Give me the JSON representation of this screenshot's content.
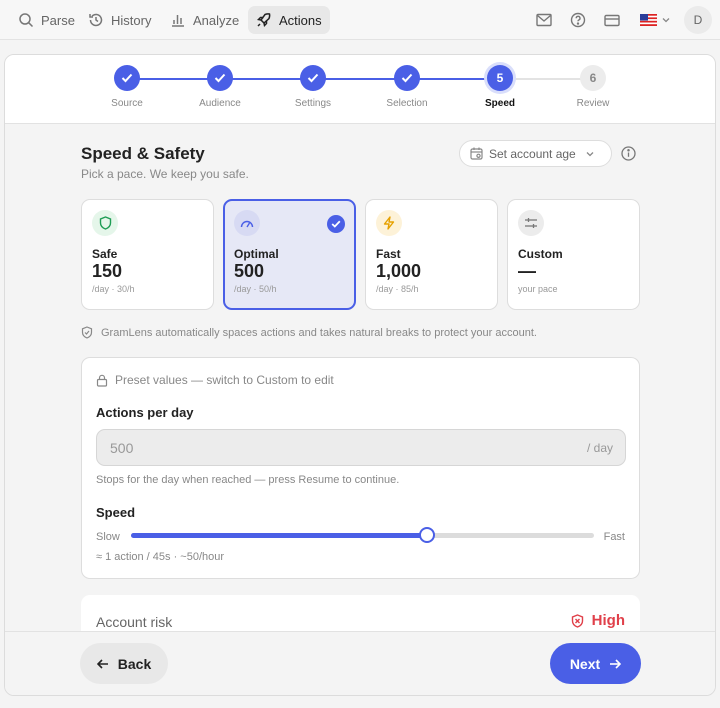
{
  "nav": {
    "items": [
      {
        "label": "Parse",
        "icon": "search-icon"
      },
      {
        "label": "History",
        "icon": "history-icon"
      },
      {
        "label": "Analyze",
        "icon": "bar-chart-icon"
      },
      {
        "label": "Actions",
        "icon": "rocket-icon"
      }
    ],
    "active": "Actions",
    "avatar": "D"
  },
  "steps": [
    {
      "number": "1",
      "label": "Source",
      "state": "done"
    },
    {
      "number": "2",
      "label": "Audience",
      "state": "done"
    },
    {
      "number": "3",
      "label": "Settings",
      "state": "done"
    },
    {
      "number": "4",
      "label": "Selection",
      "state": "done"
    },
    {
      "number": "5",
      "label": "Speed",
      "state": "current"
    },
    {
      "number": "6",
      "label": "Review",
      "state": "todo"
    }
  ],
  "page": {
    "title": "Speed & Safety",
    "subtitle": "Pick a pace. We keep you safe.",
    "account_age_label": "Set account age"
  },
  "presets": [
    {
      "name": "Safe",
      "value": "150",
      "meta": "/day · 30/h",
      "icon": "shield-icon",
      "selected": false
    },
    {
      "name": "Optimal",
      "value": "500",
      "meta": "/day · 50/h",
      "icon": "gauge-icon",
      "selected": true
    },
    {
      "name": "Fast",
      "value": "1,000",
      "meta": "/day · 85/h",
      "icon": "bolt-icon",
      "selected": false
    },
    {
      "name": "Custom",
      "value": "—",
      "meta": "your pace",
      "icon": "sliders-icon",
      "selected": false
    }
  ],
  "notice": "GramLens automatically spaces actions and takes natural breaks to protect your account.",
  "settings": {
    "preset_note": "Preset values — switch to Custom to edit",
    "actions_label": "Actions per day",
    "actions_value": "500",
    "actions_unit": "/ day",
    "actions_hint": "Stops for the day when reached — press Resume to continue.",
    "speed_label": "Speed",
    "slow_label": "Slow",
    "fast_label": "Fast",
    "speed_level": 0.64,
    "rate_text": "≈ 1 action / 45s · ~50/hour"
  },
  "risk": {
    "label": "Account risk",
    "level": "High"
  },
  "footer": {
    "back_label": "Back",
    "next_label": "Next"
  },
  "colors": {
    "accent": "#4a5fe6",
    "danger": "#e0404a",
    "safe": "#1f9d55",
    "fast": "#e6a100"
  }
}
